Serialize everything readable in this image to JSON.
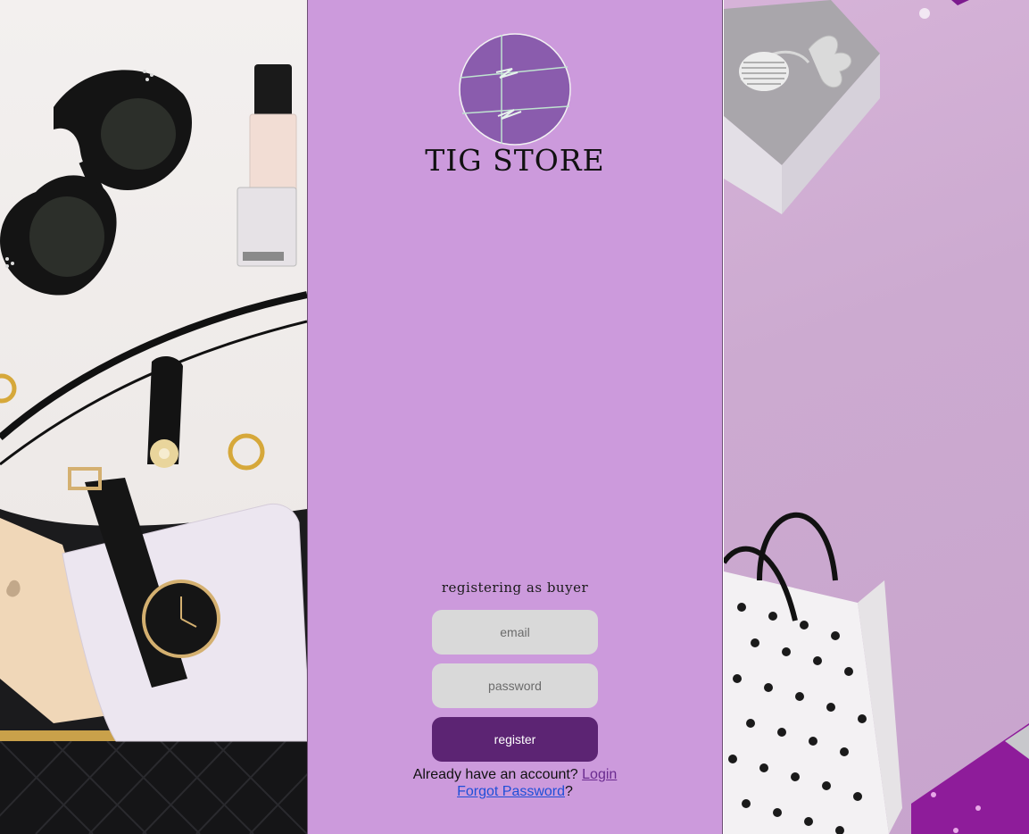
{
  "brand": {
    "name": "TIG STORE",
    "logo_icon": "tig-store-logo-icon",
    "logo_color": "#8a5cad"
  },
  "form": {
    "heading": "registering as buyer",
    "email_placeholder": "email",
    "password_placeholder": "password",
    "register_label": "register"
  },
  "footer": {
    "account_prompt": "Already have an account? ",
    "login_label": "Login",
    "forgot_label": "Forgot Password",
    "forgot_suffix": "?"
  },
  "decor": {
    "left_image_icon": "fashion-accessories-photo",
    "right_image_icon": "gift-and-shopping-bag-photo"
  },
  "colors": {
    "panel_background": "#cc9adc",
    "input_background": "#d9d9d9",
    "button_background": "#5c2473",
    "login_link": "#6a2b8f",
    "forgot_link": "#1f4fd8"
  }
}
